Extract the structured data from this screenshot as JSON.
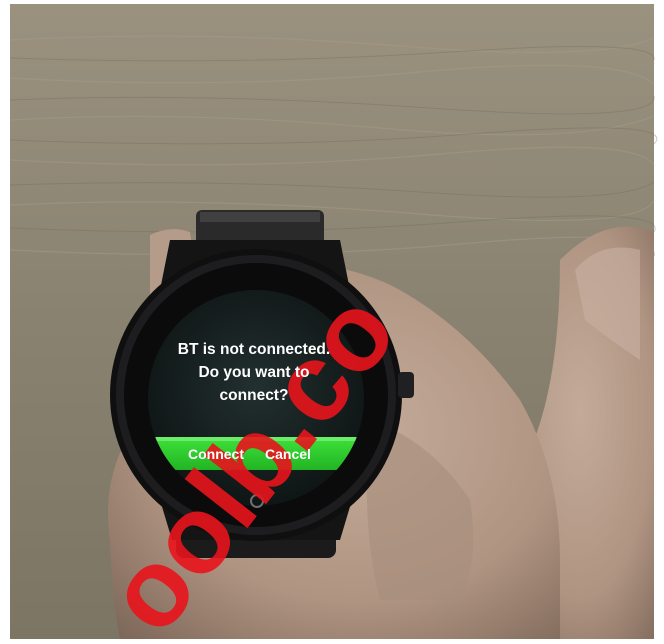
{
  "photo": {
    "subject": "smartwatch held in hand",
    "colors": {
      "wood_background": "#8a8270",
      "watch_body": "#121213",
      "screen": "#1a2224",
      "accent_green": "#2fd12f",
      "skin": "#b89e8c",
      "watermark": "#e8141c"
    }
  },
  "watch_screen": {
    "message_lines": [
      "BT is not connected.",
      "Do you want to",
      "connect?"
    ],
    "buttons": {
      "connect_label": "Connect",
      "cancel_label": "Cancel"
    },
    "home_indicator_icon": "circle-icon"
  },
  "watermark": {
    "text": "oolb.co"
  }
}
